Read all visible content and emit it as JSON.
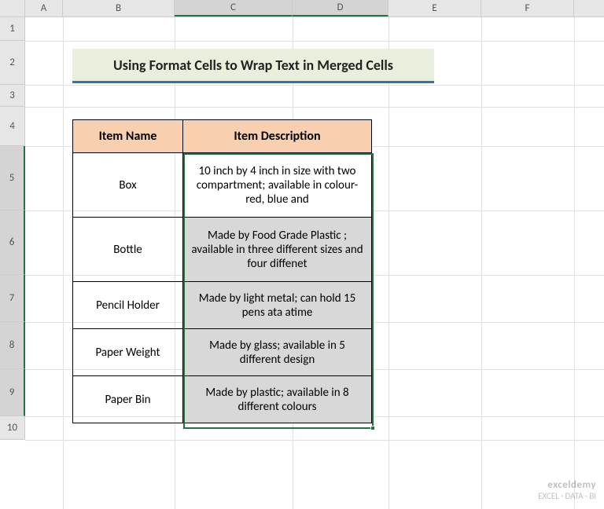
{
  "columns": [
    {
      "label": "A",
      "width": 48,
      "selected": false
    },
    {
      "label": "B",
      "width": 142,
      "selected": false
    },
    {
      "label": "C",
      "width": 150,
      "selected": true
    },
    {
      "label": "D",
      "width": 122,
      "selected": true
    },
    {
      "label": "E",
      "width": 118,
      "selected": false
    },
    {
      "label": "F",
      "width": 118,
      "selected": false
    }
  ],
  "rows": [
    {
      "label": "1",
      "height": 30,
      "selected": false
    },
    {
      "label": "2",
      "height": 56,
      "selected": false
    },
    {
      "label": "3",
      "height": 28,
      "selected": false
    },
    {
      "label": "4",
      "height": 50,
      "selected": false
    },
    {
      "label": "5",
      "height": 82,
      "selected": true
    },
    {
      "label": "6",
      "height": 82,
      "selected": true
    },
    {
      "label": "7",
      "height": 60,
      "selected": true
    },
    {
      "label": "8",
      "height": 60,
      "selected": true
    },
    {
      "label": "9",
      "height": 60,
      "selected": true
    },
    {
      "label": "10",
      "height": 30,
      "selected": false
    }
  ],
  "title": "Using Format Cells to Wrap Text in Merged Cells",
  "headers": {
    "col1": "Item Name",
    "col2": "Item Description"
  },
  "data_rows": [
    {
      "name": "Box",
      "desc": "10 inch by 4 inch in size with two compartment; available in colour-red, blue and",
      "h": 82,
      "active": true
    },
    {
      "name": "Bottle",
      "desc": "Made by Food Grade Plastic ; available in three different sizes and four diffenet",
      "h": 82,
      "active": false
    },
    {
      "name": "Pencil Holder",
      "desc": "Made by light metal; can hold 15 pens ata atime",
      "h": 60,
      "active": false
    },
    {
      "name": "Paper Weight",
      "desc": "Made by glass; available in 5 different design",
      "h": 60,
      "active": false
    },
    {
      "name": "Paper Bin",
      "desc": "Made by plastic; available in 8 different colours",
      "h": 60,
      "active": false
    }
  ],
  "watermark": {
    "title": "exceldemy",
    "subtitle": "EXCEL · DATA · BI"
  },
  "chart_data": {
    "type": "table",
    "title": "Using Format Cells to Wrap Text in Merged Cells",
    "columns": [
      "Item Name",
      "Item Description"
    ],
    "rows": [
      [
        "Box",
        "10 inch by 4 inch in size with two compartment; available in colour-red, blue and"
      ],
      [
        "Bottle",
        "Made by Food Grade Plastic ; available in three different sizes and four diffenet"
      ],
      [
        "Pencil Holder",
        "Made by light metal; can hold 15 pens ata atime"
      ],
      [
        "Paper Weight",
        "Made by glass; available in 5 different design"
      ],
      [
        "Paper Bin",
        "Made by plastic; available in 8 different colours"
      ]
    ]
  }
}
